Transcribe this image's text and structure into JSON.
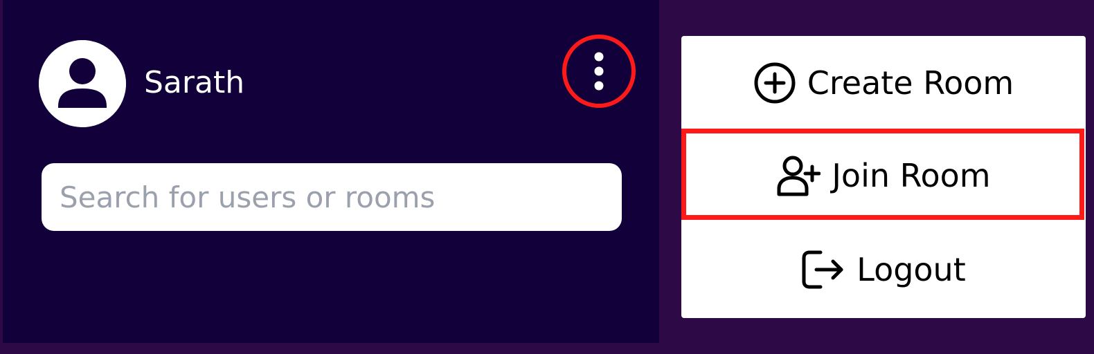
{
  "sidebar": {
    "user": {
      "name": "Sarath",
      "avatar_icon": "user-avatar-icon"
    },
    "menu_icon": "more-vertical-icon",
    "search": {
      "placeholder": "Search for users or rooms",
      "value": ""
    }
  },
  "menu": {
    "items": [
      {
        "label": "Create Room",
        "icon": "plus-circle-icon"
      },
      {
        "label": "Join Room",
        "icon": "user-plus-icon"
      },
      {
        "label": "Logout",
        "icon": "logout-icon"
      }
    ]
  },
  "colors": {
    "page_bg": "#2d0a45",
    "sidebar_bg": "#12003b",
    "highlight": "#ff1a1a",
    "menu_bg": "#ffffff"
  }
}
